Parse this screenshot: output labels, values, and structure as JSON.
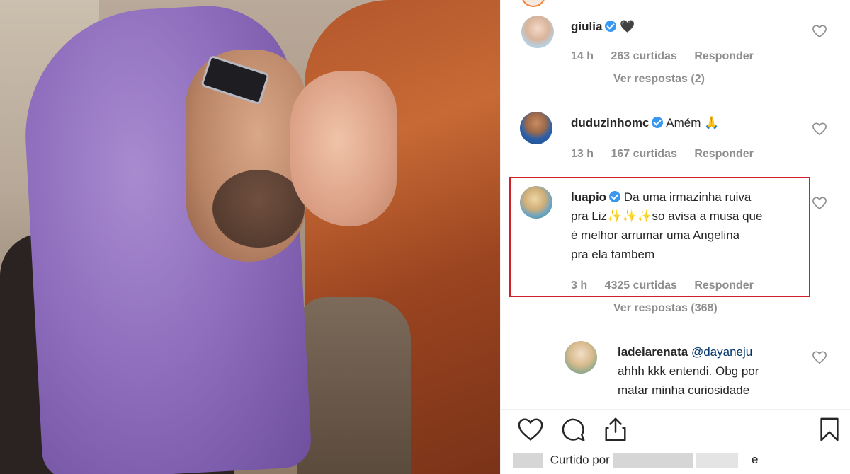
{
  "comments": [
    {
      "username": "giulia",
      "text": "🖤",
      "time": "14 h",
      "likes": "263 curtidas",
      "reply": "Responder",
      "view_replies": "Ver respostas (2)"
    },
    {
      "username": "duduzinhomc",
      "text": "Amém 🙏",
      "time": "13 h",
      "likes": "167 curtidas",
      "reply": "Responder"
    },
    {
      "username": "luapio",
      "text_lines": [
        "Da uma irmazinha ruiva",
        "pra Liz✨✨✨so avisa a musa que",
        "é melhor arrumar uma Angelina",
        "pra ela tambem"
      ],
      "time": "3 h",
      "likes": "4325 curtidas",
      "reply": "Responder",
      "view_replies": "Ver respostas (368)"
    }
  ],
  "reply_comment": {
    "username": "ladeiarenata",
    "mention": "@dayaneju",
    "text_lines": [
      "ahhh kkk entendi. Obg por",
      "matar minha curiosidade"
    ]
  },
  "footer": {
    "liked_by_label": "Curtido por",
    "and_label": "e"
  },
  "icons": {
    "like": "heart-icon",
    "comment": "comment-icon",
    "share": "share-icon",
    "save": "bookmark-icon"
  },
  "colors": {
    "highlight_border": "#d0202a",
    "verified": "#3897f0",
    "meta_text": "#8e8e8e"
  }
}
